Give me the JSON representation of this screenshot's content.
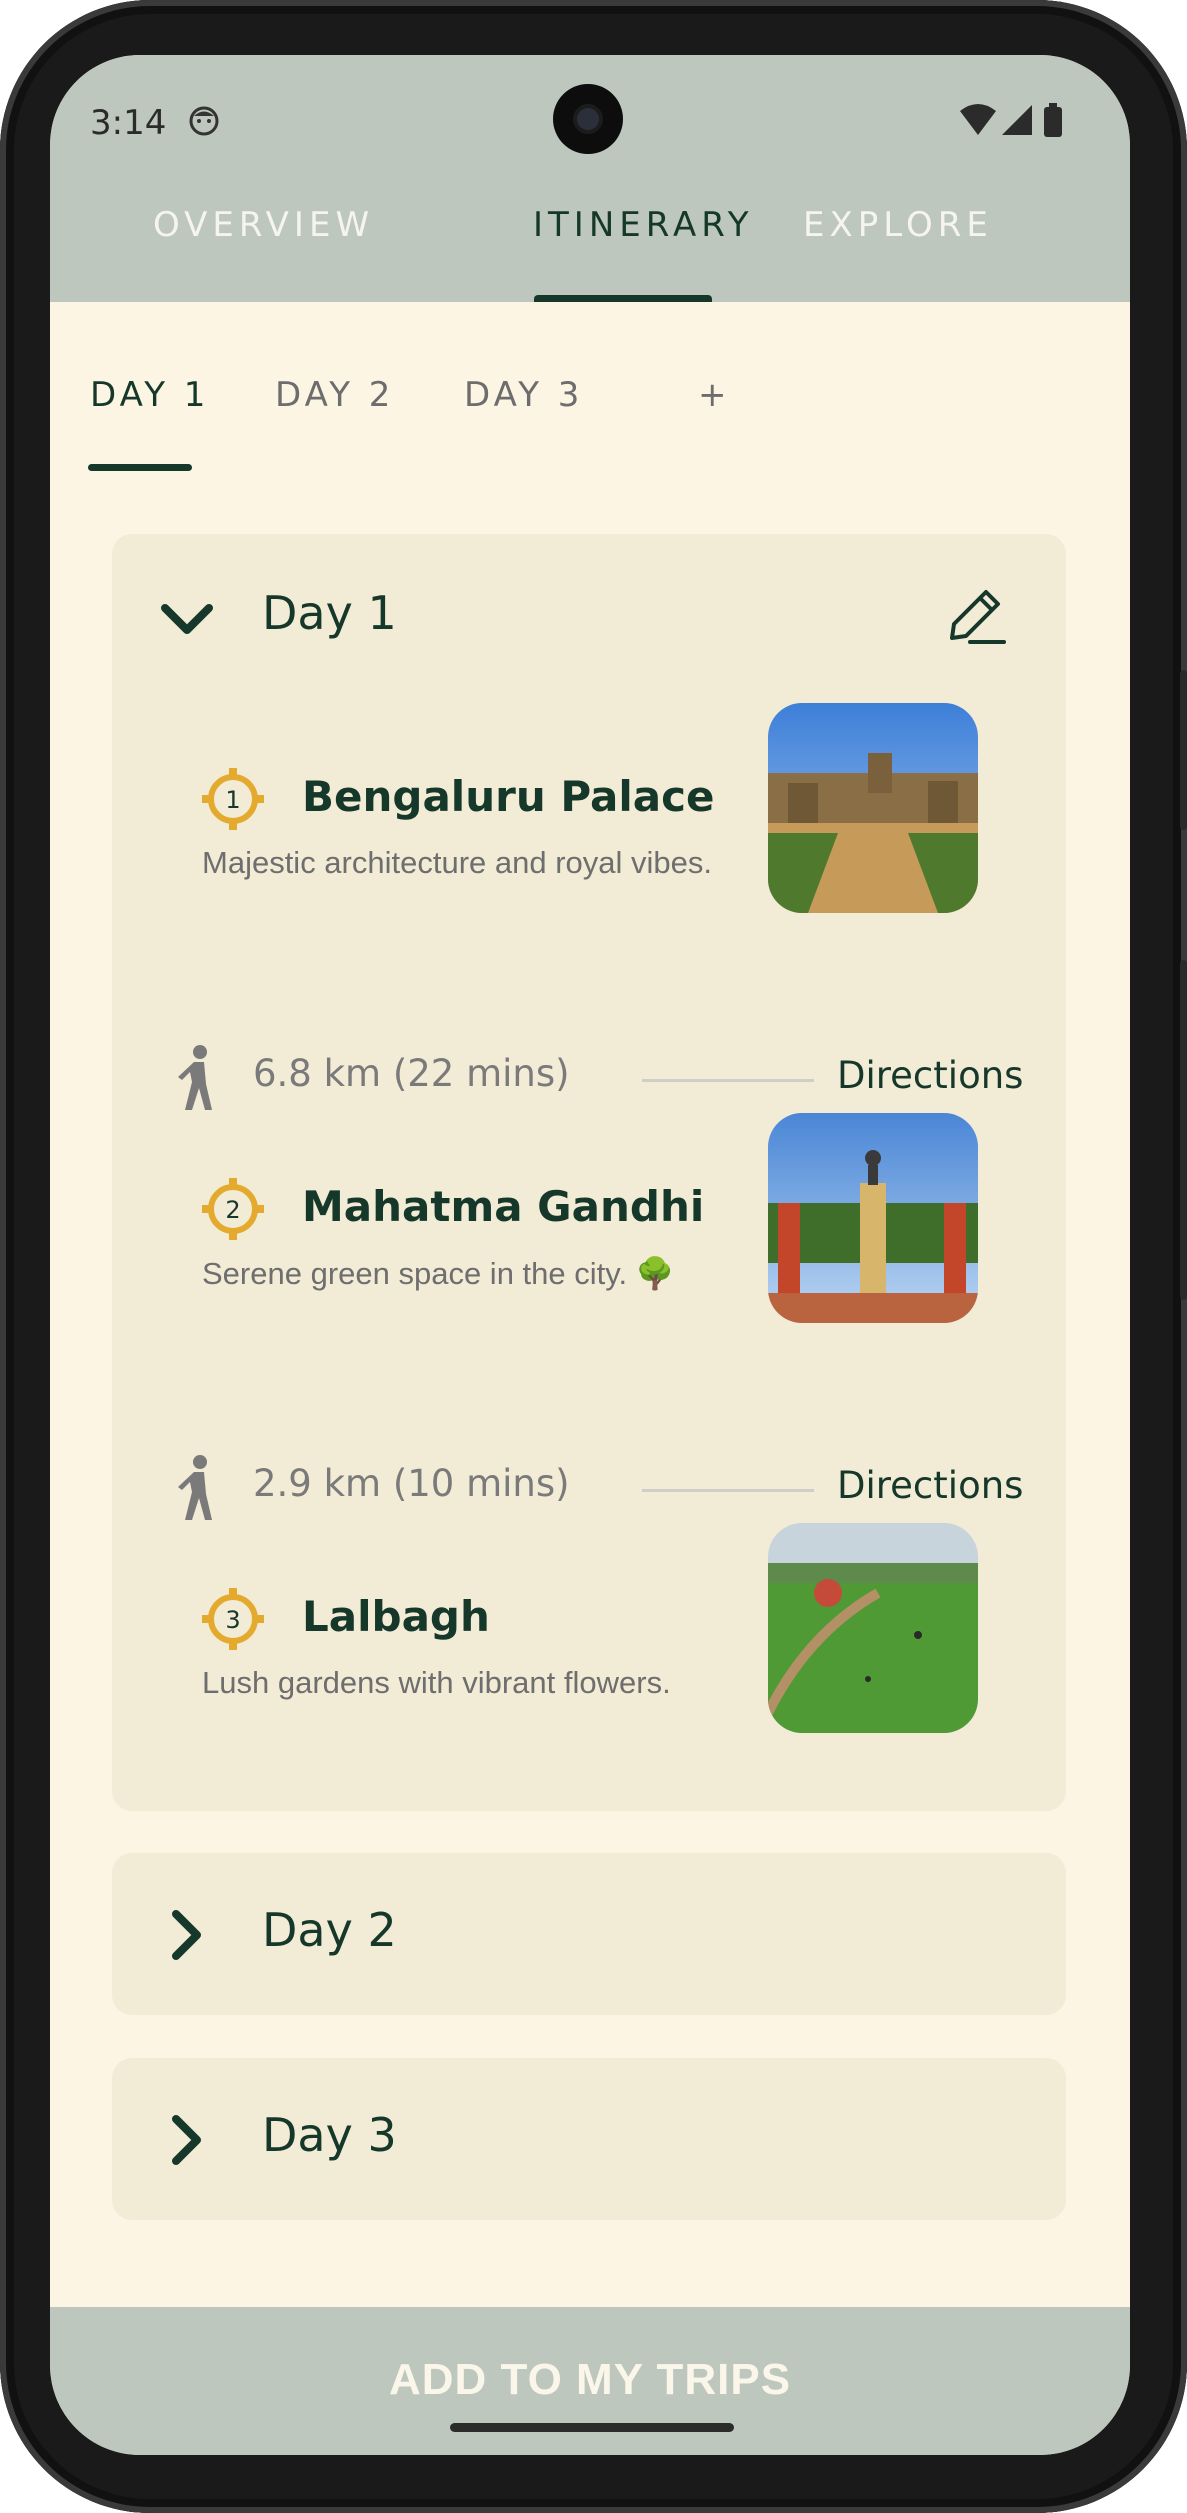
{
  "status_bar": {
    "time": "3:14"
  },
  "top_tabs": [
    {
      "label": "OVERVIEW"
    },
    {
      "label": "ITINERARY"
    },
    {
      "label": "EXPLORE"
    }
  ],
  "active_top_tab": "ITINERARY",
  "day_tabs": [
    {
      "label": "DAY 1"
    },
    {
      "label": "DAY 2"
    },
    {
      "label": "DAY 3"
    },
    {
      "label": "+"
    }
  ],
  "active_day_tab": "DAY 1",
  "days": [
    {
      "title": "Day 1",
      "expanded": true,
      "places": [
        {
          "number": "1",
          "name": "Bengaluru Palace",
          "description": "Majestic architecture and royal vibes."
        },
        {
          "number": "2",
          "name": "Mahatma Gandhi",
          "description": "Serene green space in the city. 🌳"
        },
        {
          "number": "3",
          "name": "Lalbagh",
          "description": "Lush gardens with vibrant flowers."
        }
      ],
      "legs": [
        {
          "distance": "6.8 km (22 mins)",
          "action": "Directions"
        },
        {
          "distance": "2.9 km (10 mins)",
          "action": "Directions"
        }
      ]
    },
    {
      "title": "Day 2",
      "expanded": false
    },
    {
      "title": "Day 3",
      "expanded": false
    }
  ],
  "bottom_button": {
    "label": "ADD TO MY TRIPS"
  },
  "colors": {
    "primary": "#16382a",
    "accent": "#e4aa2e",
    "background": "#fcf5e4",
    "card": "#f2ebd6",
    "top_bar": "#bdc7be"
  },
  "icons": [
    "face-icon",
    "wifi-icon",
    "signal-icon",
    "battery-icon",
    "chevron-down-icon",
    "chevron-right-icon",
    "pencil-icon",
    "walk-icon",
    "location-target-icon"
  ]
}
